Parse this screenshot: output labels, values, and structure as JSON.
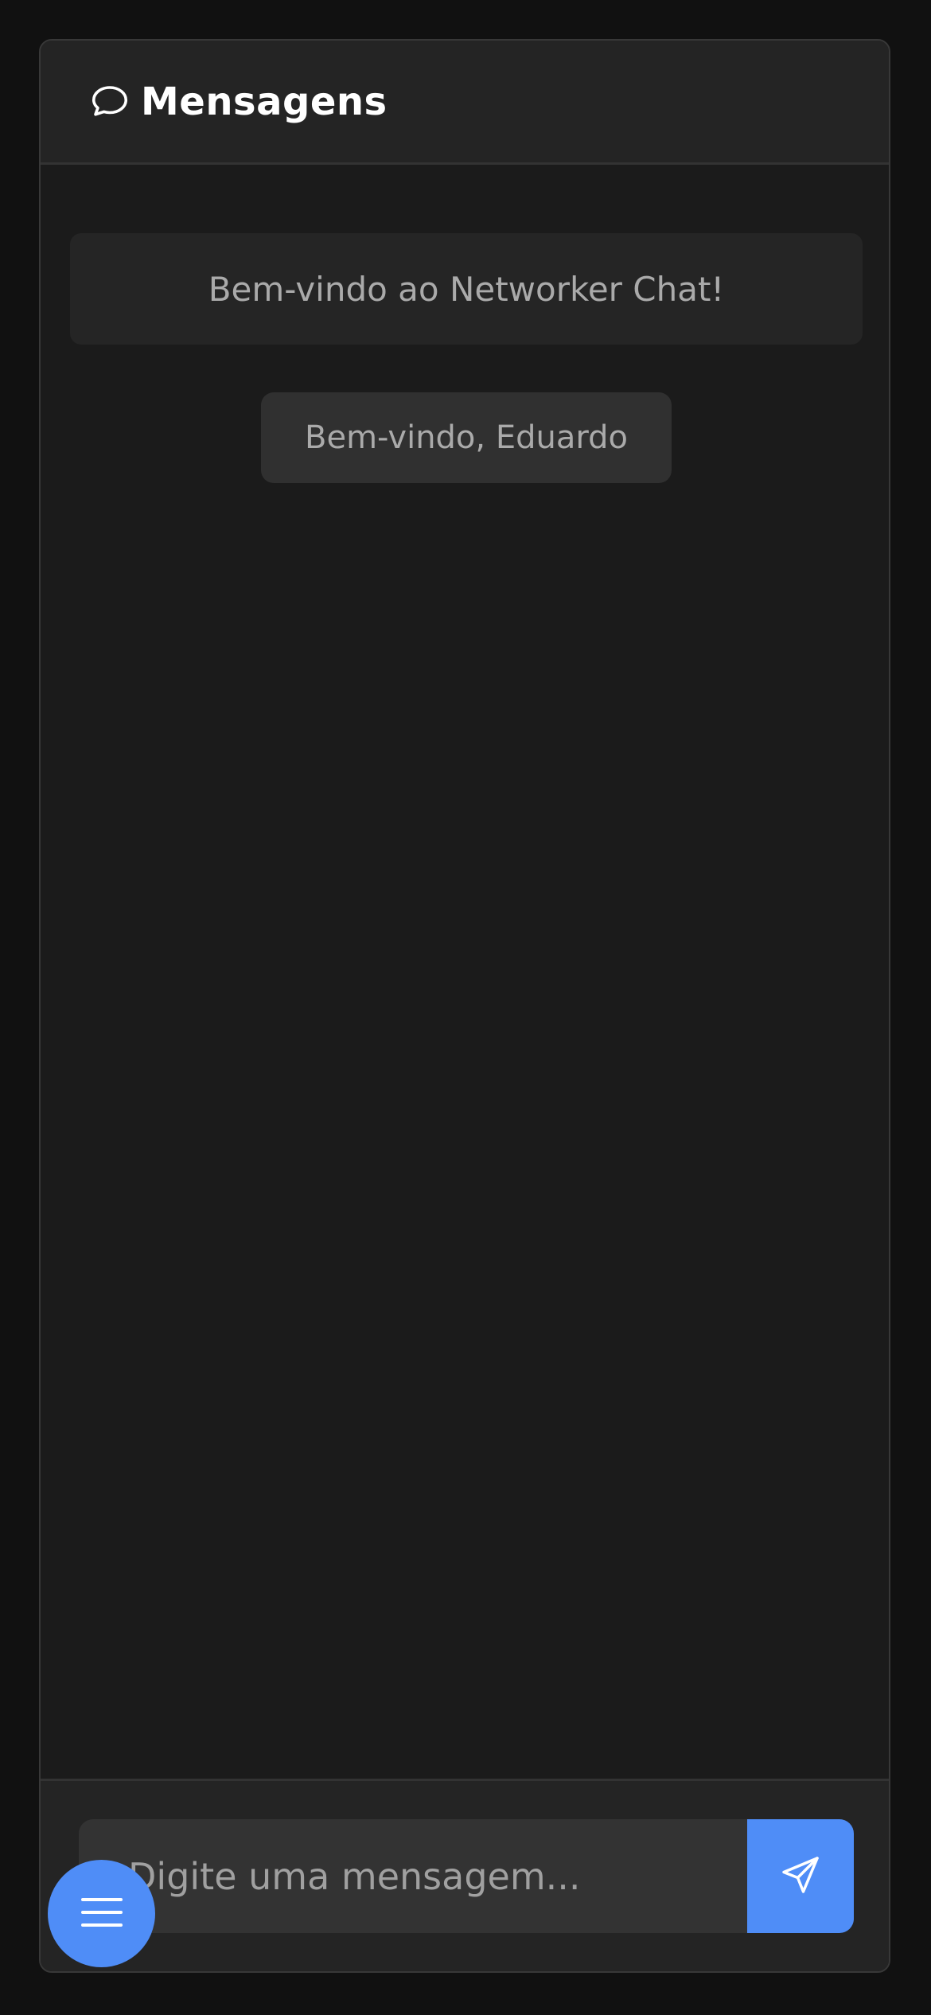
{
  "header": {
    "title": "Mensagens",
    "icon": "chat-bubble-icon"
  },
  "messages": {
    "system_banner": "Bem-vindo ao Networker Chat!",
    "welcome_chip": "Bem-vindo, Eduardo"
  },
  "composer": {
    "placeholder": "Digite uma mensagem...",
    "send_icon": "send-icon"
  },
  "fab": {
    "icon": "menu-icon"
  },
  "colors": {
    "accent": "#4f8df7",
    "background": "#111111",
    "panel": "#1b1b1b"
  }
}
